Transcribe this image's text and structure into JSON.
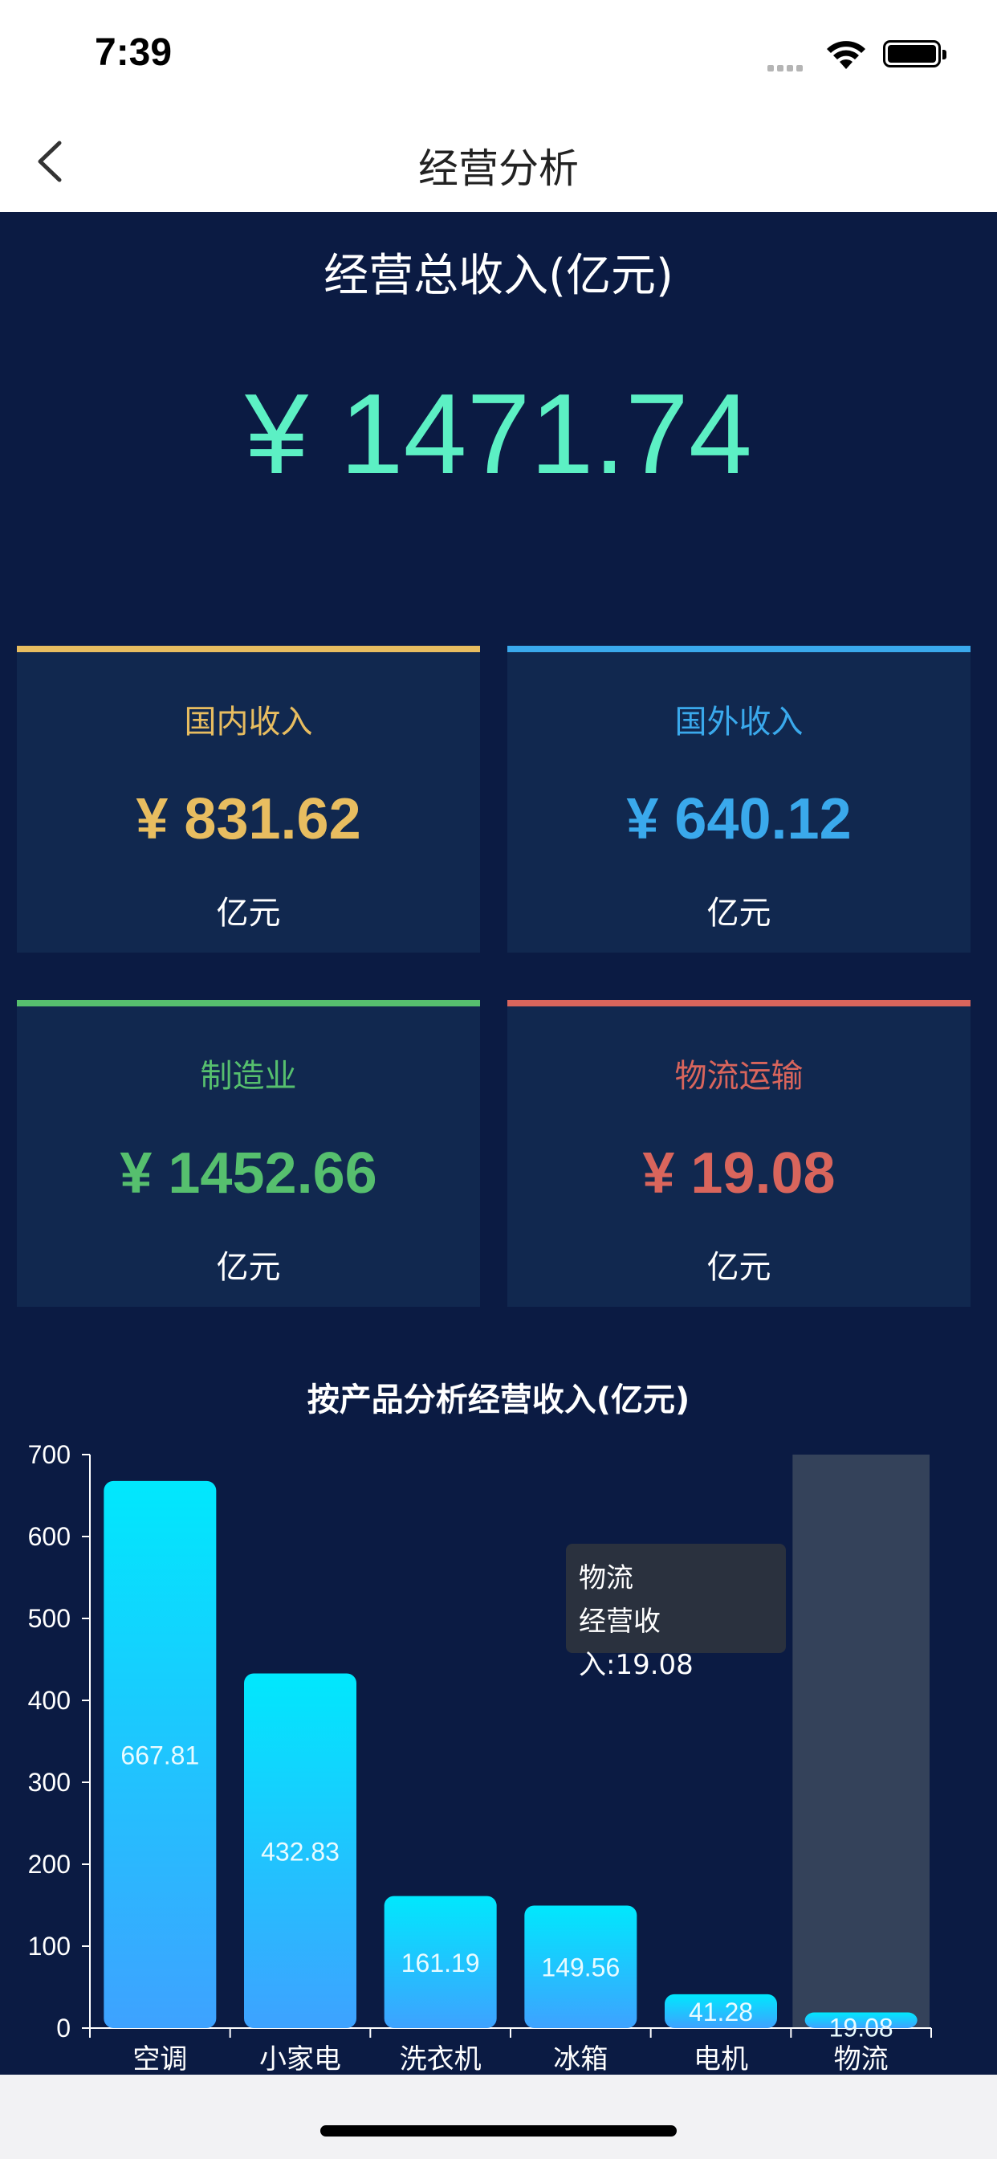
{
  "status_bar": {
    "time": "7:39"
  },
  "nav": {
    "title": "经营分析"
  },
  "summary": {
    "label": "经营总收入(亿元)",
    "value": "¥ 1471.74"
  },
  "cards": [
    {
      "label": "国内收入",
      "amount": "¥ 831.62",
      "unit": "亿元",
      "color": "#e8bd60"
    },
    {
      "label": "国外收入",
      "amount": "¥ 640.12",
      "unit": "亿元",
      "color": "#3aa9ec"
    },
    {
      "label": "制造业",
      "amount": "¥ 1452.66",
      "unit": "亿元",
      "color": "#56bf6e"
    },
    {
      "label": "物流运输",
      "amount": "¥ 19.08",
      "unit": "亿元",
      "color": "#d9655c"
    }
  ],
  "tooltip": {
    "category": "物流",
    "line": "经营收入:19.08"
  },
  "chart_data": {
    "type": "bar",
    "title": "按产品分析经营收入(亿元)",
    "categories": [
      "空调",
      "小家电",
      "洗衣机",
      "冰箱",
      "电机",
      "物流"
    ],
    "values": [
      667.81,
      432.83,
      161.19,
      149.56,
      41.28,
      19.08
    ],
    "value_labels": [
      "667.81",
      "432.83",
      "161.19",
      "149.56",
      "41.28",
      "19.08"
    ],
    "yticks": [
      "0",
      "100",
      "200",
      "300",
      "400",
      "500",
      "600",
      "700"
    ],
    "ylim": [
      0,
      700
    ],
    "highlighted_category": "物流",
    "colors": {
      "bar_top": "#00e8fd",
      "bar_bottom": "#3ea2ff",
      "highlight": "#34425a"
    }
  }
}
